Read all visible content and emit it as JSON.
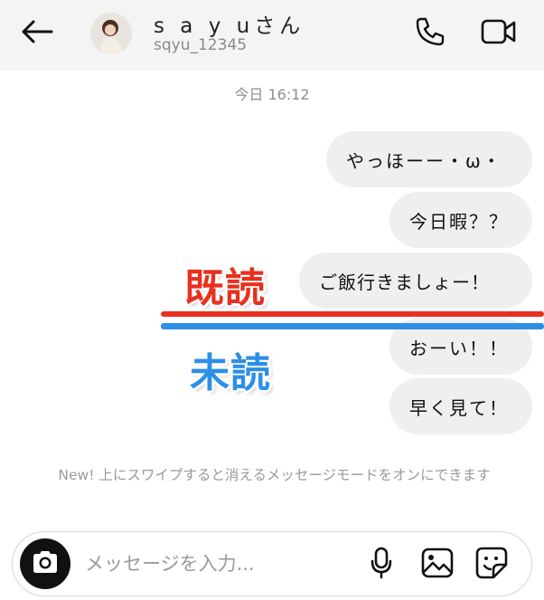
{
  "header": {
    "back_icon": "arrow-left-icon",
    "avatar_icon": "avatar",
    "name": "s a y uさん",
    "handle": "sqyu_12345",
    "call_icon": "phone-icon",
    "video_icon": "video-camera-icon"
  },
  "thread": {
    "timestamp": "今日 16:12",
    "messages": [
      {
        "text": "やっほーー・ω・"
      },
      {
        "text": "今日暇？？"
      },
      {
        "text": "ご飯行きましょー！"
      },
      {
        "text": "おーい！！"
      },
      {
        "text": "早く見て！"
      }
    ],
    "read_marker": {
      "label": "既読",
      "color": "#e8301e"
    },
    "unread_marker": {
      "label": "未読",
      "color": "#2e8fe6"
    },
    "vanish_notice": "New! 上にスワイプすると消えるメッセージモードをオンにできます"
  },
  "composer": {
    "placeholder": "メッセージを入力...",
    "value": "",
    "camera_icon": "camera-icon",
    "mic_icon": "microphone-icon",
    "gallery_icon": "image-icon",
    "sticker_icon": "sticker-icon"
  }
}
